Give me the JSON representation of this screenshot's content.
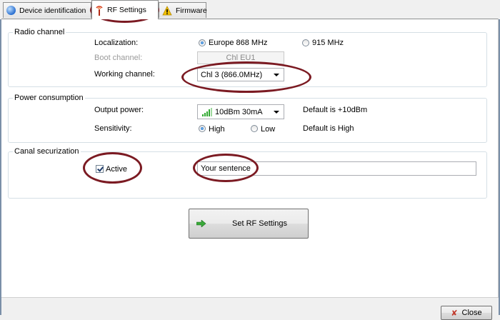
{
  "tabs": [
    {
      "label": "Device identification",
      "icon": "globe-icon"
    },
    {
      "label": "RF Settings",
      "icon": "rf-antenna-icon"
    },
    {
      "label": "Firmware",
      "icon": "warning-icon"
    }
  ],
  "radio_channel": {
    "title": "Radio channel",
    "localization_label": "Localization:",
    "opt_europe": "Europe 868 MHz",
    "opt_915": "915 MHz",
    "selected": "Europe 868 MHz",
    "boot_label": "Boot channel:",
    "boot_value": "Chl EU1",
    "working_label": "Working channel:",
    "working_value": "Chl  3   (866.0MHz)"
  },
  "power": {
    "title": "Power consumption",
    "output_label": "Output power:",
    "output_value": "10dBm 30mA",
    "output_default": "Default is +10dBm",
    "sensitivity_label": "Sensitivity:",
    "opt_high": "High",
    "opt_low": "Low",
    "sensitivity_selected": "High",
    "sensitivity_default": "Default is High"
  },
  "canal": {
    "title": "Canal securization",
    "active_label": "Active",
    "active_checked": true,
    "sentence_value": "Your sentence"
  },
  "set_button_label": "Set RF Settings",
  "close_button_label": "Close",
  "colors": {
    "annotation_ring": "#7b1a22",
    "accent": "#1b5fb4"
  }
}
